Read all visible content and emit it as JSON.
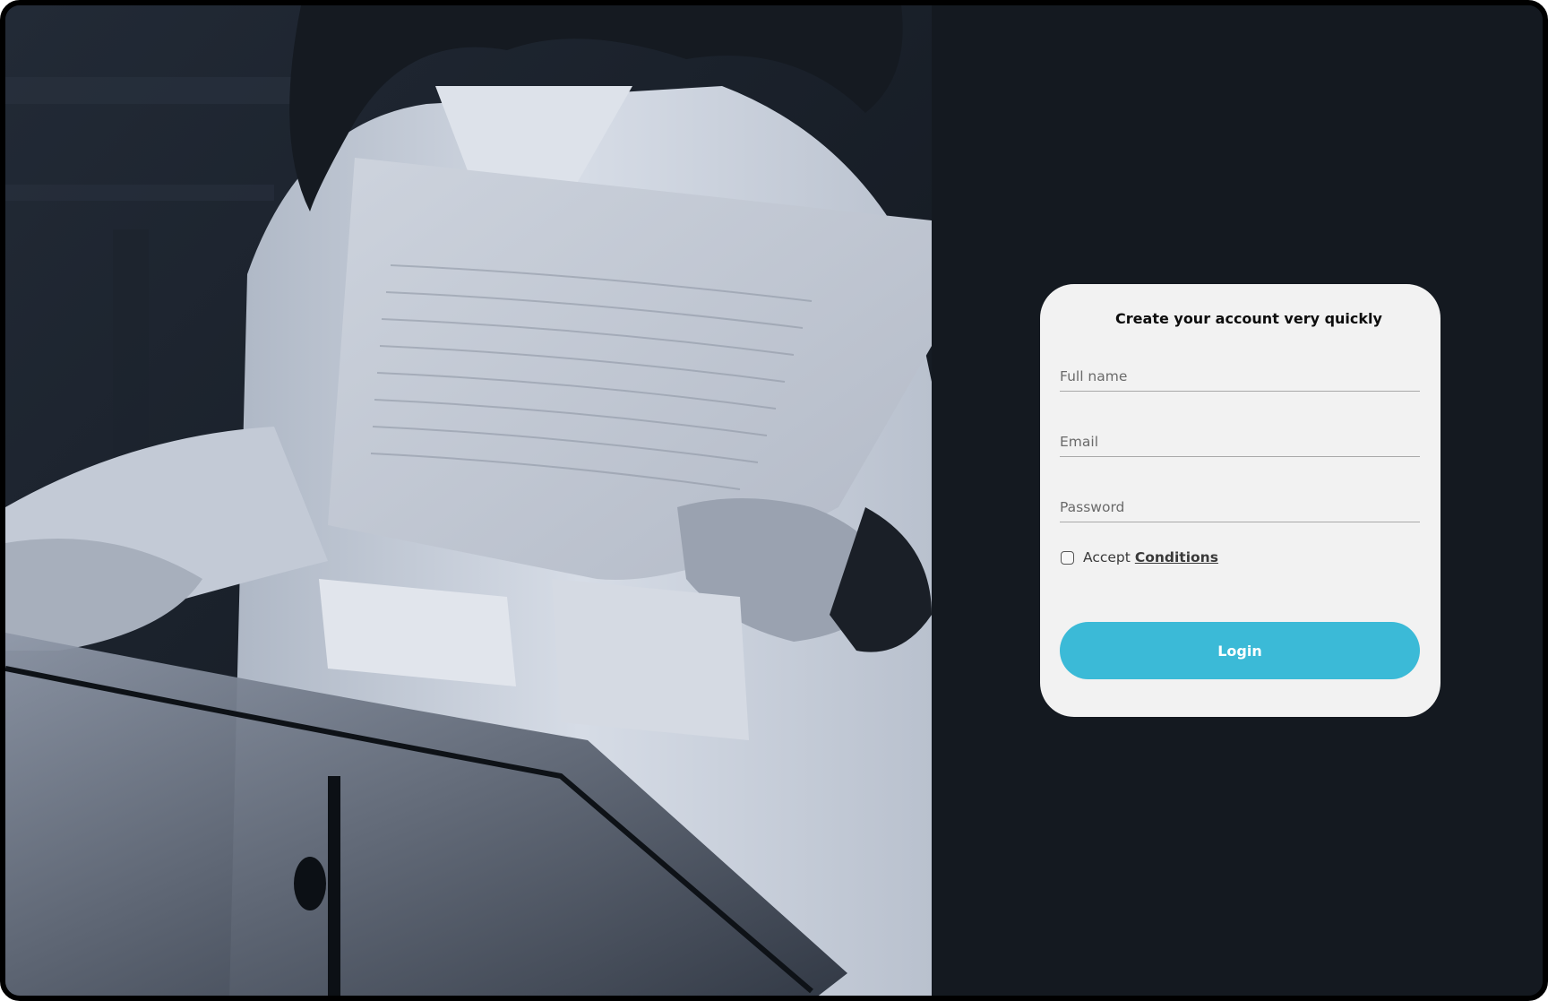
{
  "form": {
    "title": "Create your account very quickly",
    "fields": {
      "full_name": {
        "placeholder": "Full name",
        "value": ""
      },
      "email": {
        "placeholder": "Email",
        "value": ""
      },
      "password": {
        "placeholder": "Password",
        "value": ""
      }
    },
    "accept_label": "Accept",
    "conditions_link": "Conditions",
    "accept_checked": false,
    "login_label": "Login"
  },
  "colors": {
    "background": "#141920",
    "card": "#f2f2f2",
    "accent": "#3bbad7",
    "frame": "#000000"
  },
  "image": {
    "subject": "woman-reading-handwritten-sheet-music-photo"
  }
}
